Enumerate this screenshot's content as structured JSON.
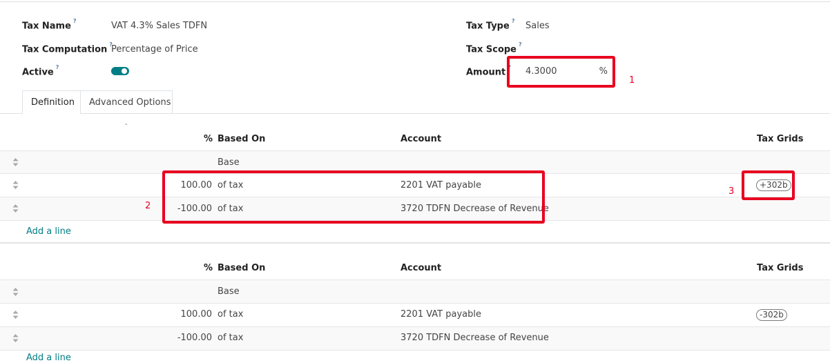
{
  "form": {
    "tax_name_label": "Tax Name",
    "tax_name_value": "VAT 4.3% Sales TDFN",
    "tax_computation_label": "Tax Computation",
    "tax_computation_value": "Percentage of Price",
    "active_label": "Active",
    "active_value": true,
    "tax_type_label": "Tax Type",
    "tax_type_value": "Sales",
    "tax_scope_label": "Tax Scope",
    "tax_scope_value": "",
    "amount_label": "Amount",
    "amount_value": "4.3000",
    "amount_unit": "%",
    "help_mark": "?"
  },
  "tabs": [
    {
      "label": "Definition",
      "active": true
    },
    {
      "label": "Advanced Options",
      "active": false
    }
  ],
  "annotations": {
    "box1": "1",
    "box2": "2",
    "box3": "3"
  },
  "colors": {
    "accent": "#017e84",
    "highlight": "#e8001f"
  },
  "invoice_table": {
    "headers": {
      "percent": "%",
      "based_on": "Based On",
      "account": "Account",
      "tax_grids": "Tax Grids"
    },
    "rows": [
      {
        "percent": "",
        "based_on": "Base",
        "account": "",
        "tax_grid": ""
      },
      {
        "percent": "100.00",
        "based_on": "of tax",
        "account": "2201 VAT payable",
        "tax_grid": "+302b"
      },
      {
        "percent": "-100.00",
        "based_on": "of tax",
        "account": "3720 TDFN Decrease of Revenue",
        "tax_grid": ""
      }
    ],
    "add_line": "Add a line"
  },
  "refund_table": {
    "headers": {
      "percent": "%",
      "based_on": "Based On",
      "account": "Account",
      "tax_grids": "Tax Grids"
    },
    "rows": [
      {
        "percent": "",
        "based_on": "Base",
        "account": "",
        "tax_grid": ""
      },
      {
        "percent": "100.00",
        "based_on": "of tax",
        "account": "2201 VAT payable",
        "tax_grid": "-302b"
      },
      {
        "percent": "-100.00",
        "based_on": "of tax",
        "account": "3720 TDFN Decrease of Revenue",
        "tax_grid": ""
      }
    ],
    "add_line": "Add a line"
  }
}
